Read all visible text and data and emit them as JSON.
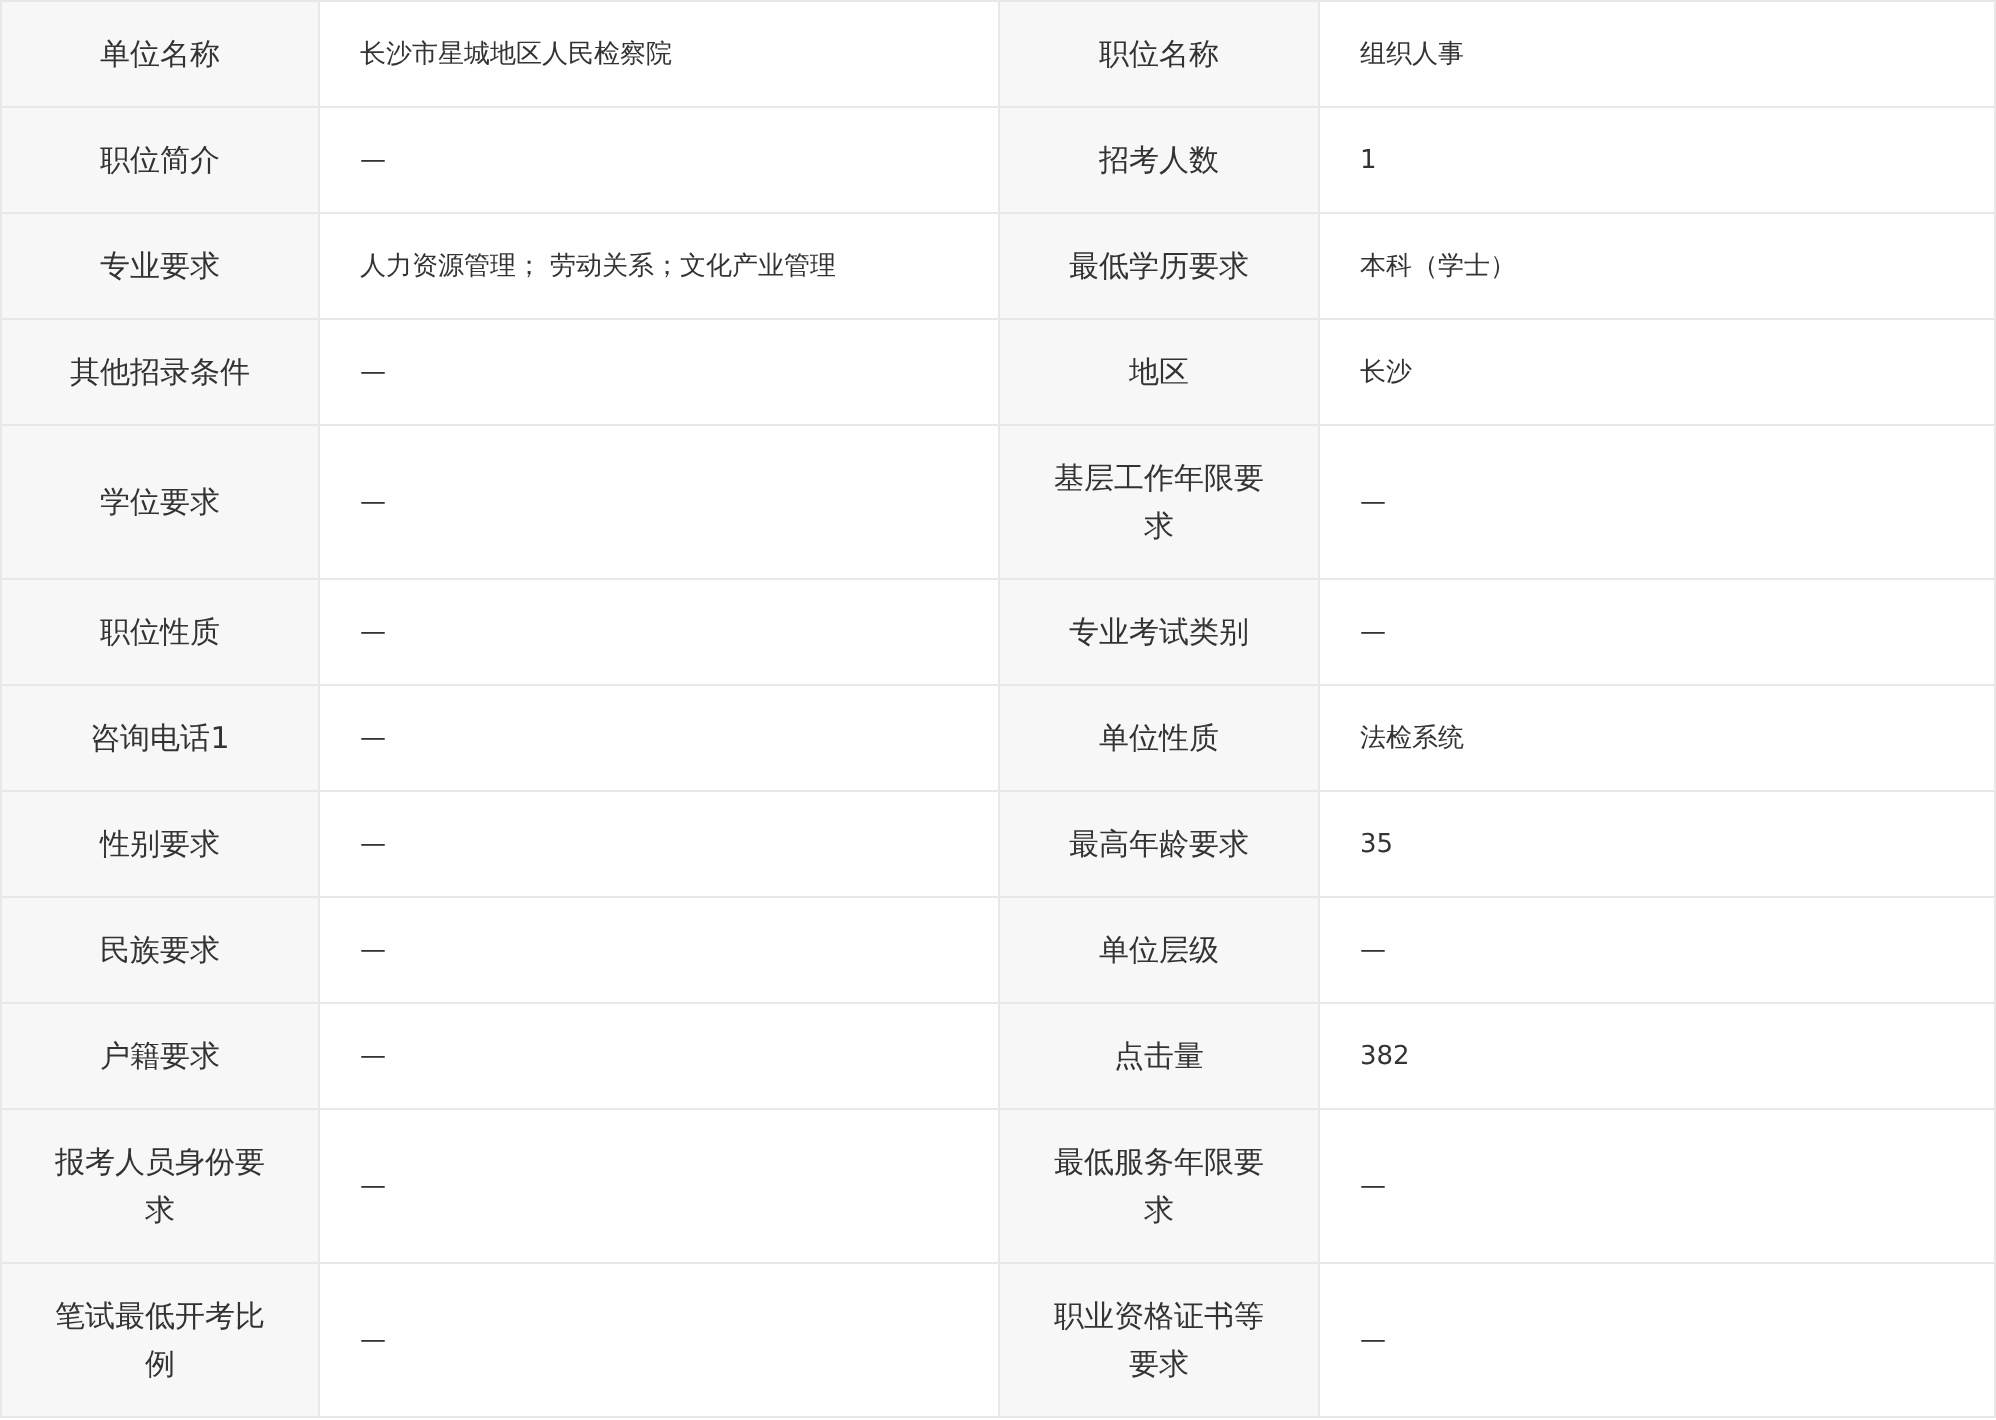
{
  "rows": [
    {
      "fields": [
        {
          "label": "单位名称",
          "value": "长沙市星城地区人民检察院"
        },
        {
          "label": "职位名称",
          "value": "组织人事"
        }
      ]
    },
    {
      "fields": [
        {
          "label": "职位简介",
          "value": "—"
        },
        {
          "label": "招考人数",
          "value": "1"
        }
      ]
    },
    {
      "fields": [
        {
          "label": "专业要求",
          "value": "人力资源管理； 劳动关系；文化产业管理"
        },
        {
          "label": "最低学历要求",
          "value": "本科（学士）"
        }
      ]
    },
    {
      "fields": [
        {
          "label": "其他招录条件",
          "value": "—"
        },
        {
          "label": "地区",
          "value": "长沙"
        }
      ]
    },
    {
      "fields": [
        {
          "label": "学位要求",
          "value": "—"
        },
        {
          "label": "基层工作年限要求",
          "value": "—"
        }
      ]
    },
    {
      "fields": [
        {
          "label": "职位性质",
          "value": "—"
        },
        {
          "label": "专业考试类别",
          "value": "—"
        }
      ]
    },
    {
      "fields": [
        {
          "label": "咨询电话1",
          "value": "—"
        },
        {
          "label": "单位性质",
          "value": "法检系统"
        }
      ]
    },
    {
      "fields": [
        {
          "label": "性别要求",
          "value": "—"
        },
        {
          "label": "最高年龄要求",
          "value": "35"
        }
      ]
    },
    {
      "fields": [
        {
          "label": "民族要求",
          "value": "—"
        },
        {
          "label": "单位层级",
          "value": "—"
        }
      ]
    },
    {
      "fields": [
        {
          "label": "户籍要求",
          "value": "—"
        },
        {
          "label": "点击量",
          "value": "382"
        }
      ]
    },
    {
      "fields": [
        {
          "label": "报考人员身份要求",
          "value": "—"
        },
        {
          "label": "最低服务年限要求",
          "value": "—"
        }
      ]
    },
    {
      "fields": [
        {
          "label": "笔试最低开考比例",
          "value": "—"
        },
        {
          "label": "职业资格证书等要求",
          "value": "—"
        }
      ]
    }
  ]
}
